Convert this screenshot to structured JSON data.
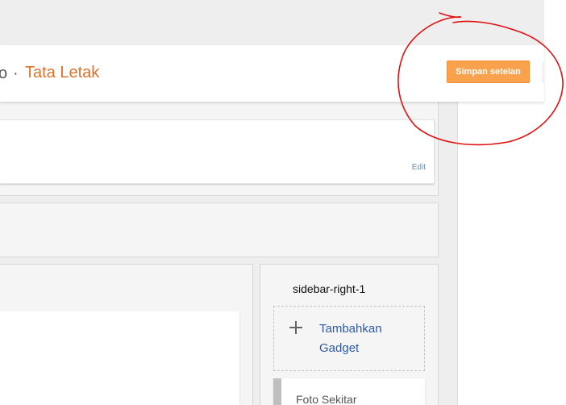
{
  "header": {
    "breadcrumb_prev": "o",
    "breadcrumb_separator": "·",
    "breadcrumb_current": "Tata Letak",
    "save_label": "Simpan setelan"
  },
  "layout": {
    "header_section": {
      "edit_label": "Edit"
    },
    "sidebar": {
      "title": "sidebar-right-1",
      "add_gadget_label": "Tambahkan Gadget",
      "gadgets": [
        {
          "label": "Foto Sekitar"
        }
      ]
    }
  },
  "colors": {
    "accent": "#e0712a",
    "save_button": "#f9a14d",
    "link": "#2c5aa9",
    "annotation": "#e01010"
  }
}
